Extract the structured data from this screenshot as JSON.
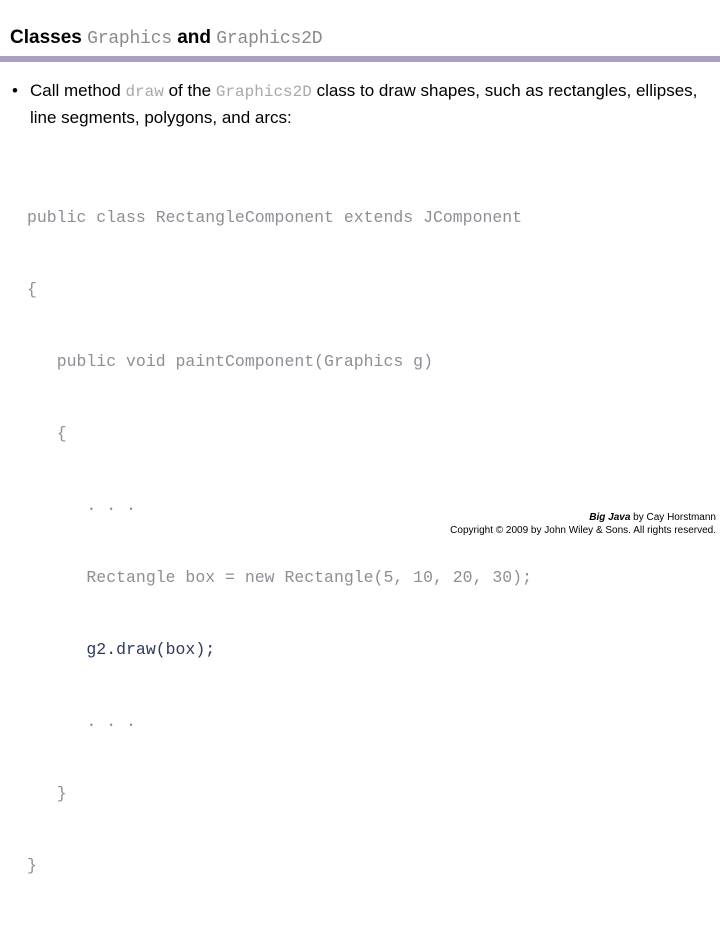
{
  "slide": {
    "title": {
      "part1": "Classes ",
      "code1": "Graphics",
      "part2": " and ",
      "code2": "Graphics2D"
    },
    "divider_color": "#aaa0c4",
    "bullet": {
      "marker": "•",
      "line1_a": "Call method ",
      "line1_code": "draw",
      "line1_b": "  of the ",
      "line1_code2": "Graphics2D",
      "line1_c": " class to draw shapes,",
      "line2": "such as rectangles, ellipses, line segments, polygons, and arcs:"
    },
    "code": {
      "lines": [
        {
          "text": "public class RectangleComponent extends JComponent",
          "emphasis": false
        },
        {
          "text": "{",
          "emphasis": false
        },
        {
          "text": "   public void paintComponent(Graphics g)",
          "emphasis": false
        },
        {
          "text": "   {",
          "emphasis": false
        },
        {
          "text": "      . . .",
          "emphasis": false
        },
        {
          "text": "      Rectangle box = new Rectangle(5, 10, 20, 30);",
          "emphasis": false
        },
        {
          "text": "      g2.draw(box);",
          "emphasis": true
        },
        {
          "text": "      . . .",
          "emphasis": false
        },
        {
          "text": "   }",
          "emphasis": false
        },
        {
          "text": "}",
          "emphasis": false
        }
      ],
      "normal_color": "#8e8e96",
      "emphasis_color": "#2b3a66"
    },
    "footer": {
      "book_title": "Big Java",
      "credit_rest": " by Cay Horstmann",
      "copyright": "Copyright © 2009 by John Wiley & Sons.  All rights reserved."
    }
  }
}
